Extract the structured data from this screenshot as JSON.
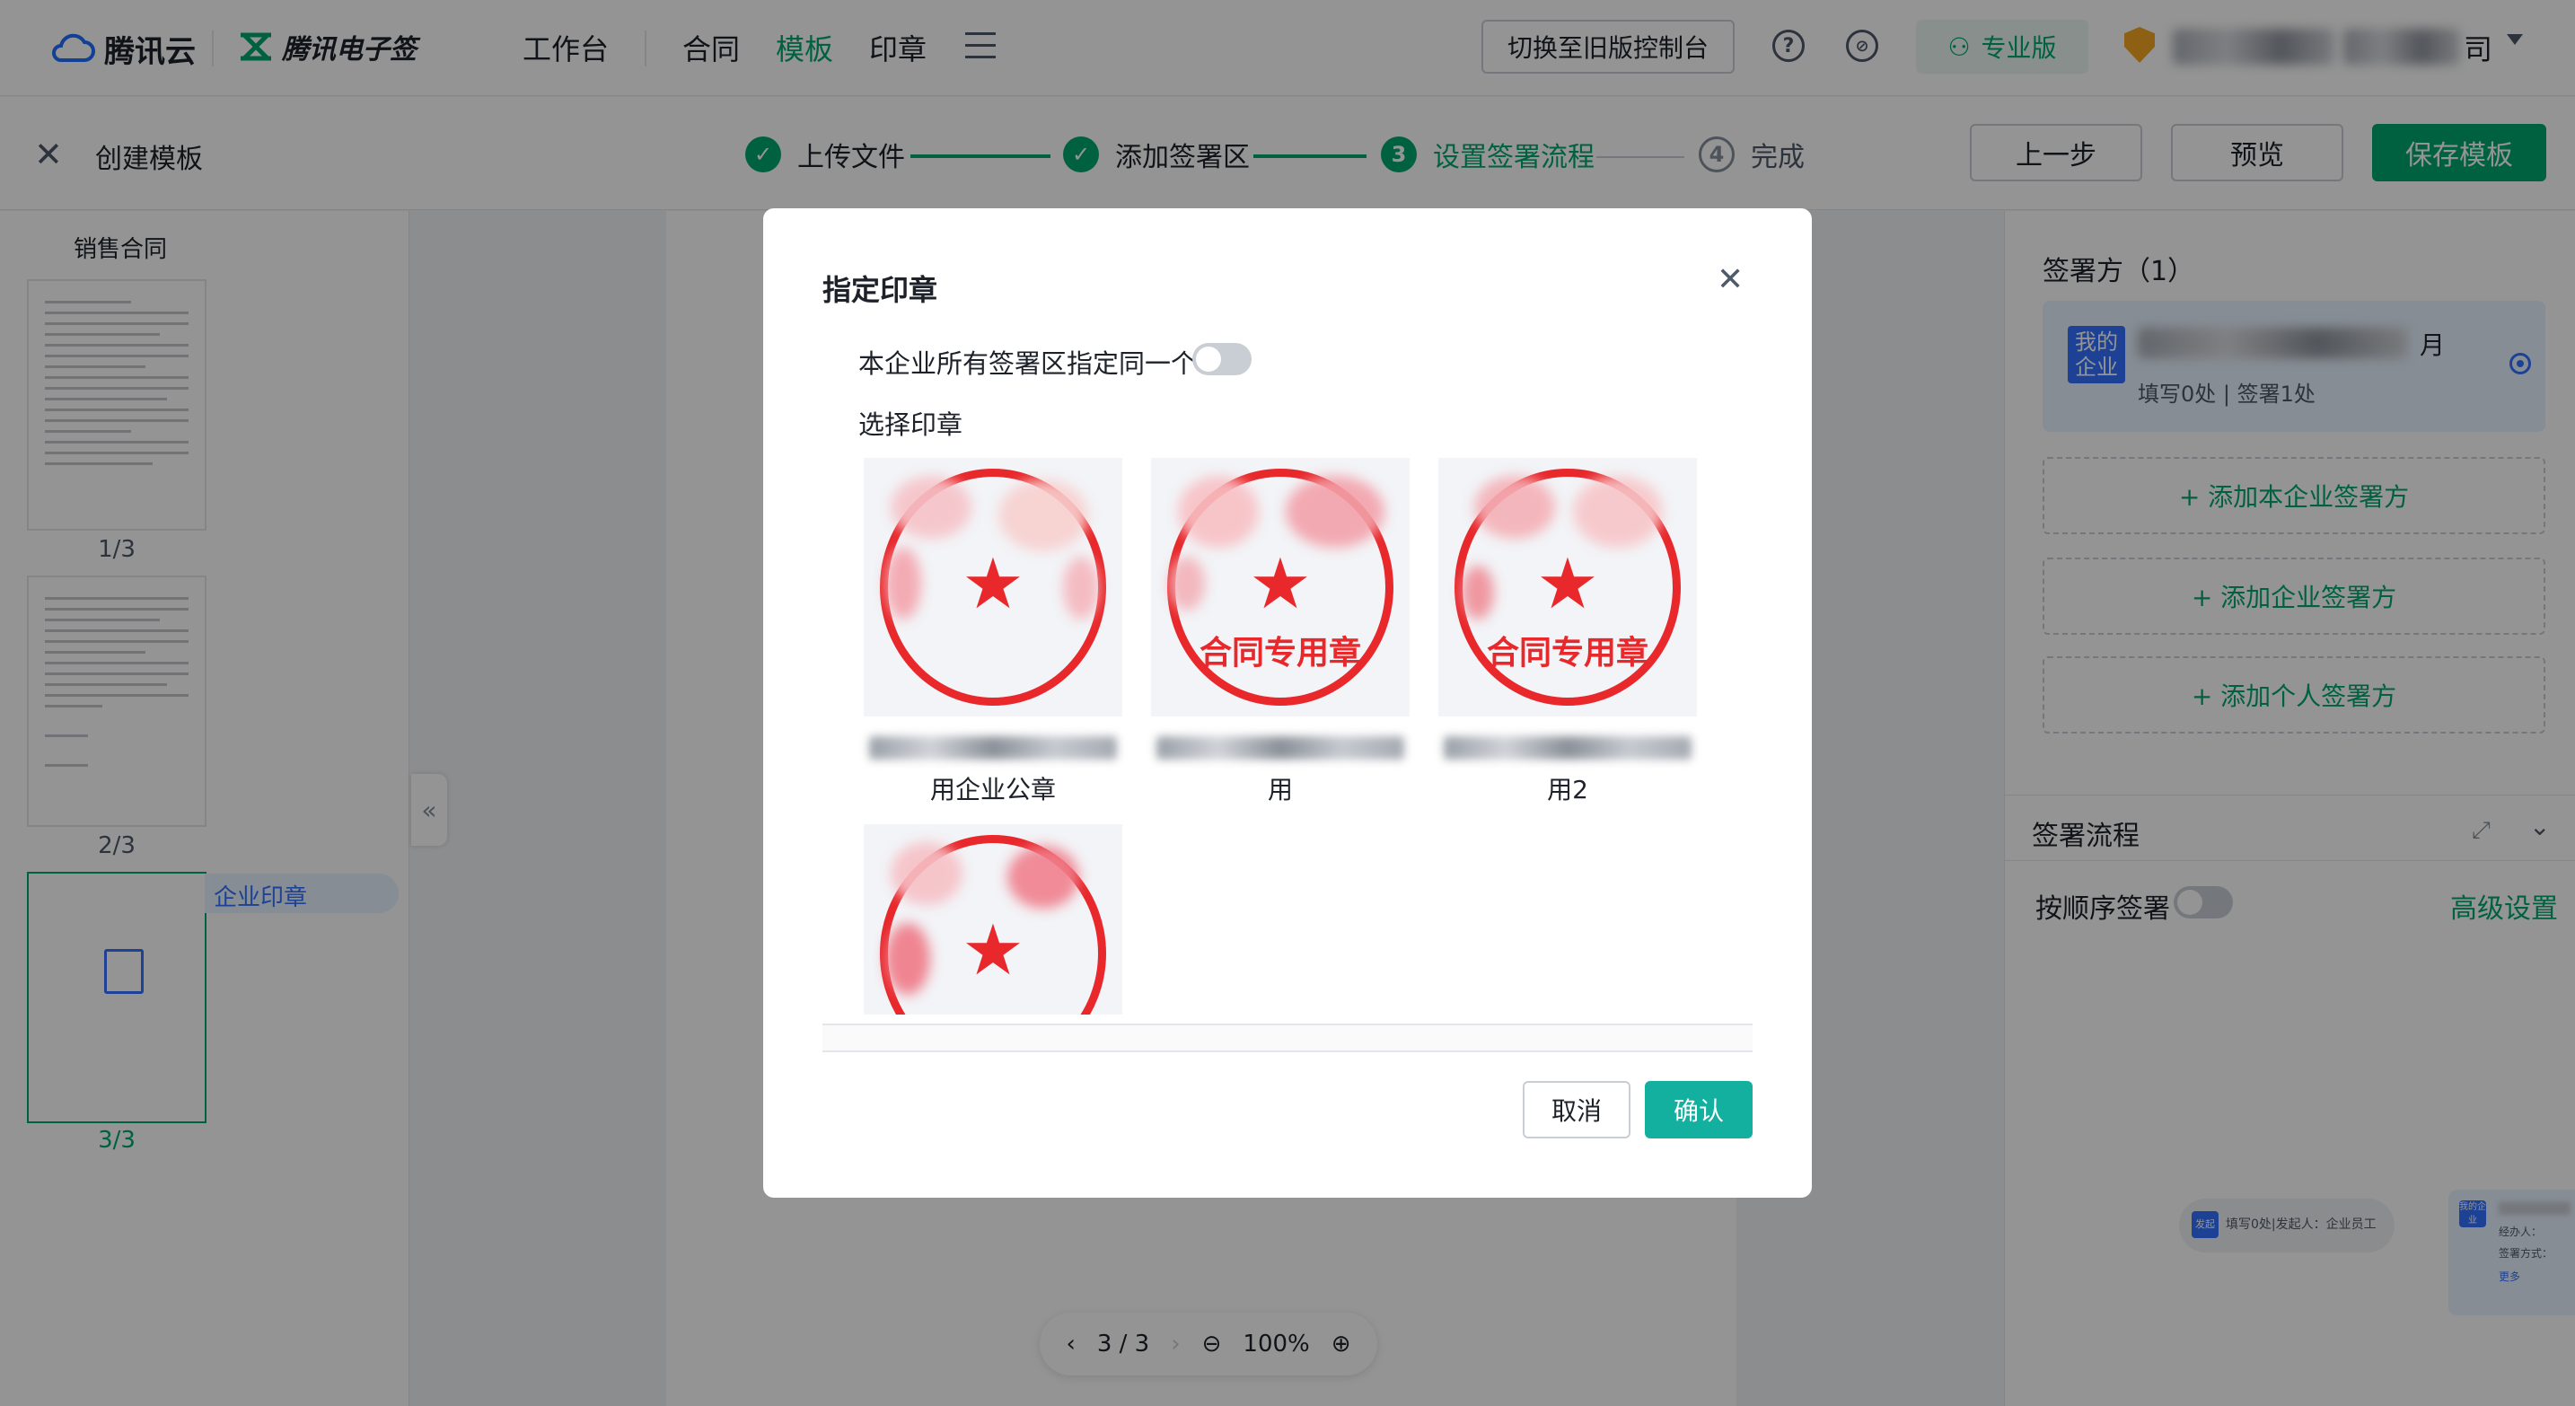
{
  "nav": {
    "brand1": "腾讯云",
    "brand2": "腾讯电子签",
    "links": [
      "工作台",
      "合同",
      "模板",
      "印章"
    ],
    "active_link": "模板",
    "switch_old": "切换至旧版控制台",
    "edition": "专业版",
    "user_suffix": "司",
    "accent": "#00a870"
  },
  "subheader": {
    "title": "创建模板",
    "steps": [
      {
        "label": "上传文件",
        "state": "done"
      },
      {
        "label": "添加签署区",
        "state": "done"
      },
      {
        "num": "3",
        "label": "设置签署流程",
        "state": "current"
      },
      {
        "num": "4",
        "label": "完成",
        "state": "todo"
      }
    ],
    "prev": "上一步",
    "preview": "预览",
    "save": "保存模板"
  },
  "left": {
    "doc_name": "销售合同",
    "pages": [
      "1/3",
      "2/3",
      "3/3"
    ],
    "seal_tag": "企业印章"
  },
  "zoom": {
    "page": "3 / 3",
    "level": "100%"
  },
  "right": {
    "signers_title": "签署方（1）",
    "my_company": "我的企业",
    "signer_suffix": "月",
    "signer_sub": "填写0处 | 签署1处",
    "add_own": "+ 添加本企业签署方",
    "add_company": "+ 添加企业签署方",
    "add_person": "+ 添加个人签署方",
    "flow_title": "签署流程",
    "order_sign": "按顺序签署",
    "advanced": "高级设置",
    "mini_node_tag_1": "发起",
    "mini_node_text_1": "填写0处|发起人：企业员工",
    "mini_node_tag_2": "我的企业",
    "mini_node_lines": [
      "经办人：",
      "签署方式：",
      "更多"
    ]
  },
  "modal": {
    "title": "指定印章",
    "same_seal_label": "本企业所有签署区指定同一个",
    "same_seal_on": false,
    "choose_label": "选择印章",
    "seals": [
      {
        "name": "用企业公章",
        "text": ""
      },
      {
        "name": "用",
        "text": "合同专用章"
      },
      {
        "name": "用2",
        "text": "合同专用章"
      },
      {
        "name": "",
        "text": ""
      }
    ],
    "cancel": "取消",
    "confirm": "确认",
    "seal_color": "#e8282b",
    "confirm_color": "#13b0a0"
  }
}
